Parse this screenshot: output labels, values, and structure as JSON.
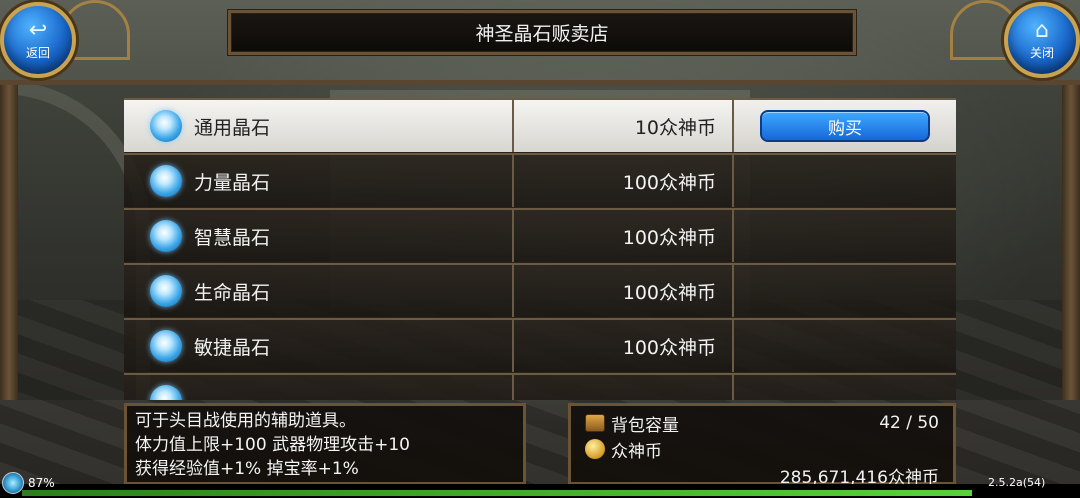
{
  "header": {
    "title": "神圣晶石贩卖店",
    "back_label": "返回",
    "close_label": "关闭"
  },
  "shop": {
    "buy_label": "购买",
    "items": [
      {
        "name": "通用晶石",
        "price": "10众神币",
        "selected": true
      },
      {
        "name": "力量晶石",
        "price": "100众神币",
        "selected": false
      },
      {
        "name": "智慧晶石",
        "price": "100众神币",
        "selected": false
      },
      {
        "name": "生命晶石",
        "price": "100众神币",
        "selected": false
      },
      {
        "name": "敏捷晶石",
        "price": "100众神币",
        "selected": false
      }
    ]
  },
  "description": {
    "lines": [
      "可于头目战使用的辅助道具。",
      "体力值上限+100 武器物理攻击+10",
      "获得经验值+1% 掉宝率+1%"
    ]
  },
  "inventory": {
    "bag_label": "背包容量",
    "bag_value": "42 / 50",
    "currency_label": "众神币",
    "currency_value": "285,671,416众神币"
  },
  "status": {
    "battery": "87%",
    "version": "2.5.2a(54)"
  },
  "colors": {
    "frame_gold": "#6b5436",
    "button_blue": "#1767d9",
    "gem_blue": "#3aa6e8",
    "xp_green": "#5ad23a"
  }
}
